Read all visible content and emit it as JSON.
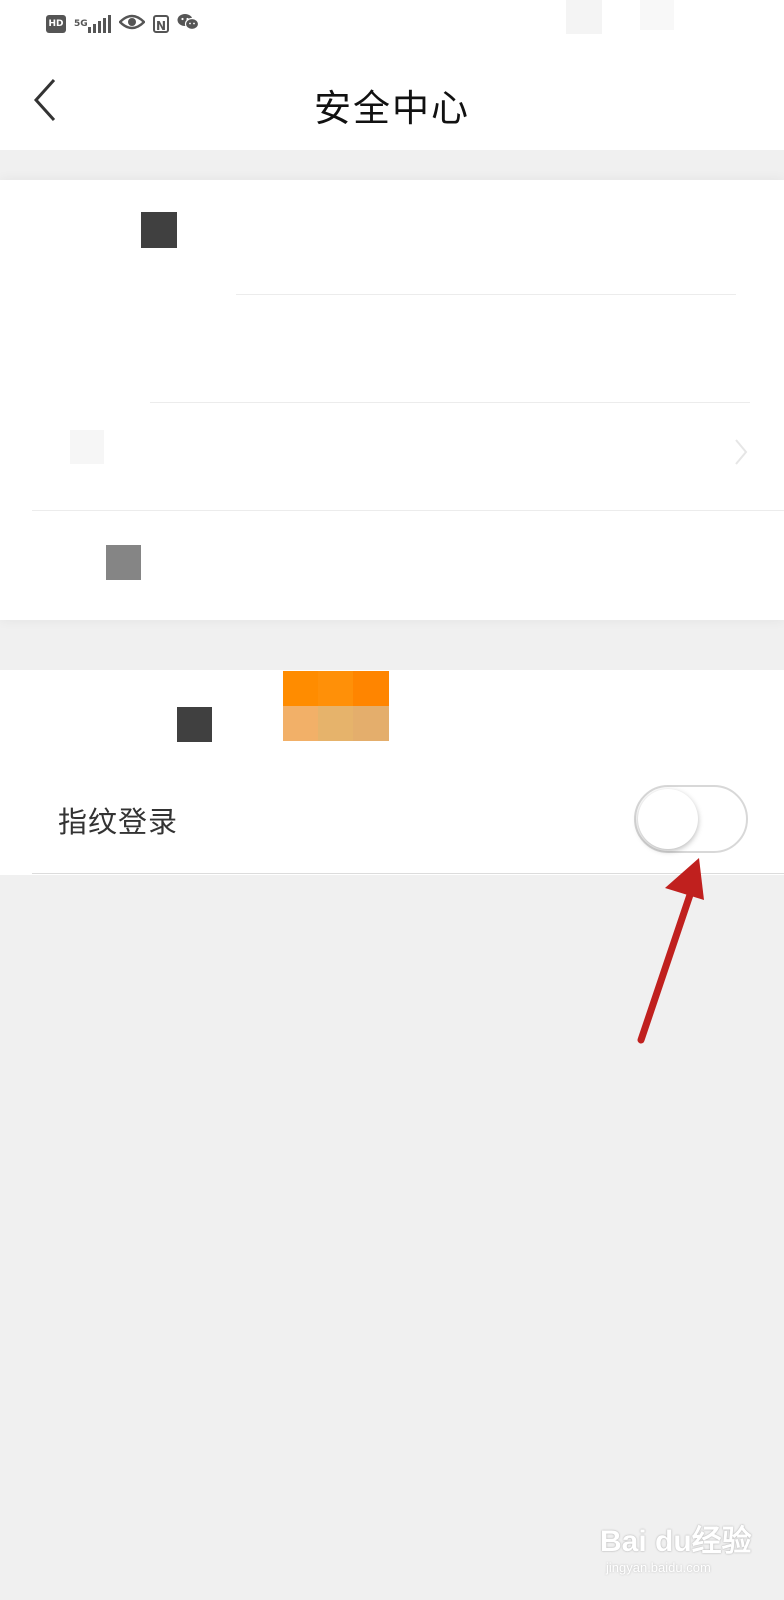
{
  "status_bar": {
    "icons": [
      "hd-icon",
      "5g-signal-icon",
      "eye-icon",
      "nfc-icon",
      "wechat-icon"
    ],
    "hd_text": "HD",
    "network_text": "5G",
    "nfc_text": "N"
  },
  "header": {
    "back_icon": "chevron-left-icon",
    "title": "安全中心"
  },
  "settings": {
    "fingerprint_login": {
      "label": "指纹登录",
      "enabled": false
    }
  },
  "watermark": {
    "main": "Bai du经验",
    "sub": "jingyan.baidu.com"
  },
  "colors": {
    "annotation_arrow": "#c0201e",
    "background": "#f0f0f0",
    "orange_pixel": "#ff8c00"
  }
}
